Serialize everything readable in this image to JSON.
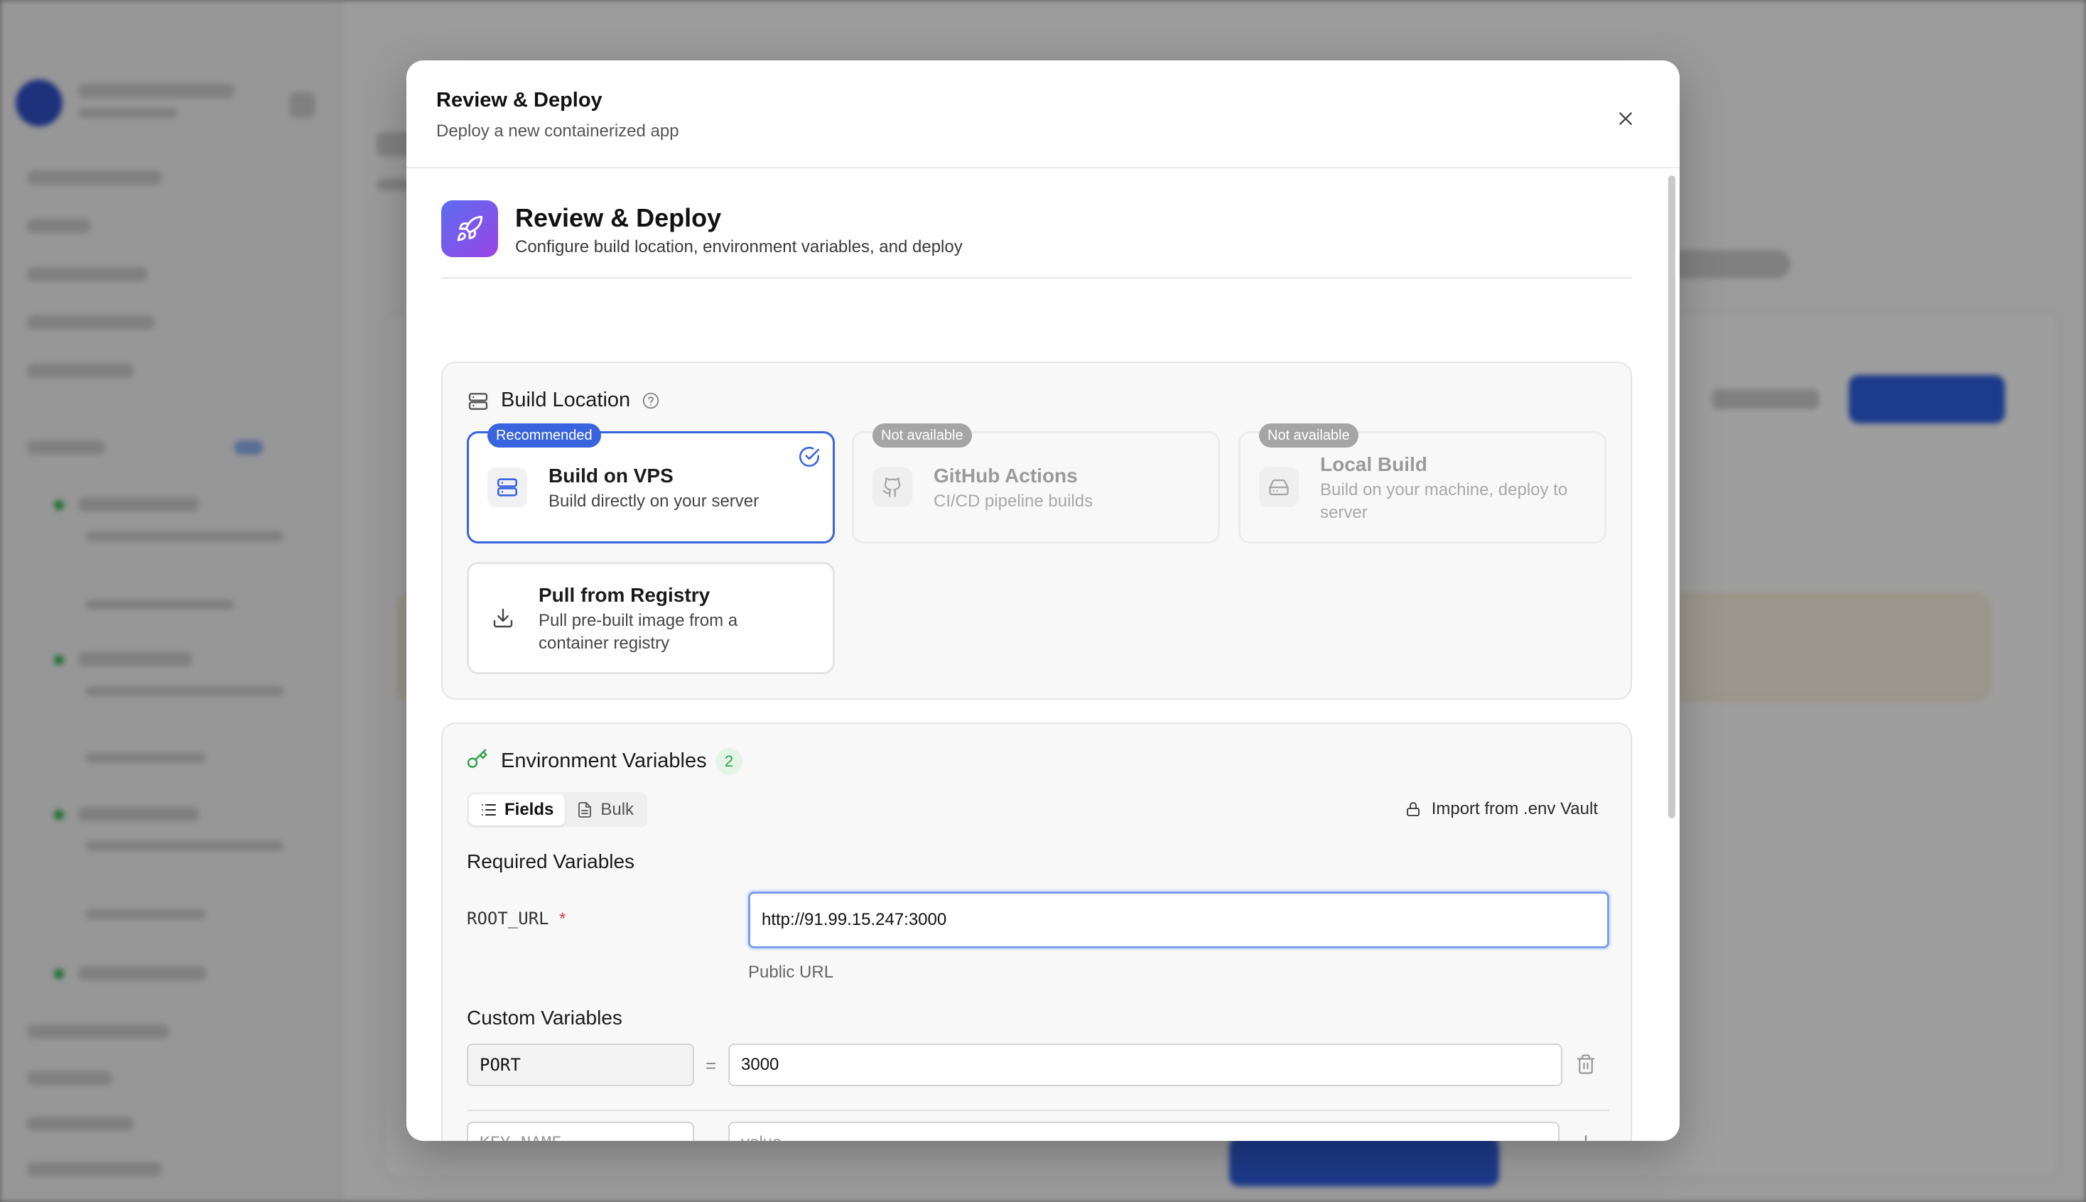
{
  "modal": {
    "title": "Review & Deploy",
    "subtitle": "Deploy a new containerized app",
    "close_icon": "close-icon"
  },
  "section": {
    "title": "Review & Deploy",
    "subtitle": "Configure build location, environment variables, and deploy",
    "icon": "rocket-icon"
  },
  "build_location": {
    "title": "Build Location",
    "help_icon": "help-circle-icon",
    "options": [
      {
        "badge": "Recommended",
        "title": "Build on VPS",
        "desc": "Build directly on your server",
        "icon": "server-icon",
        "selected": true,
        "available": true
      },
      {
        "badge": "Not available",
        "title": "GitHub Actions",
        "desc": "CI/CD pipeline builds",
        "icon": "github-icon",
        "selected": false,
        "available": false
      },
      {
        "badge": "Not available",
        "title": "Local Build",
        "desc": "Build on your machine, deploy to server",
        "icon": "hard-drive-icon",
        "selected": false,
        "available": false
      },
      {
        "badge": "",
        "title": "Pull from Registry",
        "desc": "Pull pre-built image from a container registry",
        "icon": "download-icon",
        "selected": false,
        "available": true
      }
    ]
  },
  "env": {
    "title": "Environment Variables",
    "count": "2",
    "tabs": {
      "fields": "Fields",
      "bulk": "Bulk"
    },
    "import_label": "Import from .env Vault",
    "required_heading": "Required Variables",
    "root_url": {
      "key": "ROOT_URL",
      "required_mark": "*",
      "value": "http://91.99.15.247:3000",
      "hint": "Public URL"
    },
    "custom_heading": "Custom Variables",
    "custom": [
      {
        "key": "PORT",
        "value": "3000"
      }
    ],
    "new_row": {
      "key_placeholder": "KEY_NAME",
      "value_placeholder": "value"
    },
    "equals": "="
  },
  "colors": {
    "accent": "#3a63de",
    "env_green": "#2fa14a",
    "gradient_start": "#5b6cf0",
    "gradient_end": "#9a45e6"
  }
}
